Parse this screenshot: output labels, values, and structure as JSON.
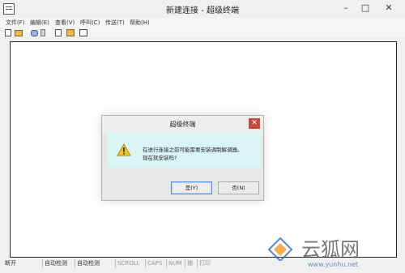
{
  "window": {
    "title": "新建连接 - 超级终端"
  },
  "menu": {
    "items": [
      "文件(F)",
      "编辑(E)",
      "查看(V)",
      "呼叫(C)",
      "传送(T)",
      "帮助(H)"
    ]
  },
  "statusbar": {
    "connection": "断开",
    "detect1": "自动检测",
    "detect2": "自动检测",
    "scroll": "SCROLL",
    "caps": "CAPS",
    "num": "NUM",
    "capture": "捕",
    "print": "打印"
  },
  "dialog": {
    "title": "超级终端",
    "message_line1": "在进行连接之前可能需要安装调制解调器。",
    "message_line2": "现在就安装吗?",
    "yes_label": "是(Y)",
    "no_label": "否(N)"
  },
  "watermark": {
    "url": "www.yunhu.net"
  },
  "colors": {
    "dialog_body": "#d9f5f5",
    "close_button": "#c9483e",
    "warning_yellow": "#f3c230"
  }
}
